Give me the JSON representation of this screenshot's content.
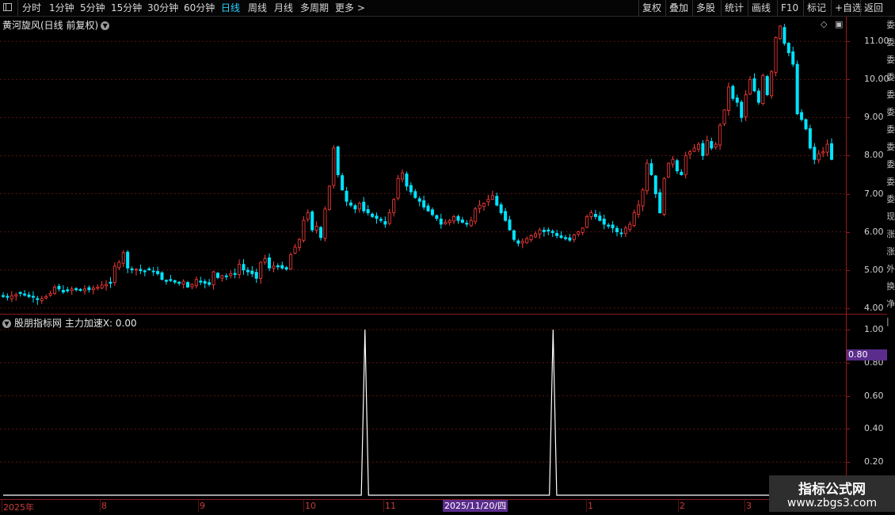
{
  "toolbar": {
    "left_items": [
      "分时",
      "1分钟",
      "5分钟",
      "15分钟",
      "30分钟",
      "60分钟",
      "日线",
      "周线",
      "月线",
      "多周期",
      "更多 >"
    ],
    "active_item": "日线",
    "right_items": [
      "复权",
      "叠加",
      "多股",
      "统计",
      "画线",
      "F10",
      "标记",
      "+自选",
      "返回"
    ]
  },
  "price_panel": {
    "title": "黄河旋风(日线 前复权)"
  },
  "indicator_panel": {
    "title": "股朋指标网 主力加速X: 0.00",
    "marker_value": "0.80"
  },
  "price_axis_labels": [
    "11.00",
    "10.00",
    "9.00",
    "8.00",
    "7.00",
    "6.00",
    "5.00",
    "4.00"
  ],
  "indicator_axis_labels": [
    "1.00",
    "0.80",
    "0.60",
    "0.40",
    "0.20"
  ],
  "date_axis": {
    "labels": [
      "2025年",
      "8",
      "9",
      "10",
      "11",
      "1",
      "2",
      "3"
    ],
    "cursor_date": "2025/11/20/四"
  },
  "side_strip_chars": [
    "委",
    "委",
    "委",
    "委",
    "委",
    "委",
    "委",
    "委",
    "委",
    "委",
    "委",
    "现",
    "涨",
    "涨",
    "外",
    "换",
    "净",
    "|"
  ],
  "watermark": {
    "line1": "指标公式网",
    "line2": "www.zbgs3.com"
  },
  "colors": {
    "up": "#ff3c3c",
    "down": "#00e4ff",
    "grid": "#5a1414",
    "axis": "#9a1a1a",
    "active_tab": "#25d4ff",
    "marker": "#5a2c8c"
  },
  "chart_data": [
    {
      "type": "candlestick",
      "title": "黄河旋风(日线 前复权)",
      "ylim": [
        3.85,
        11.65
      ],
      "yticks": [
        4,
        5,
        6,
        7,
        8,
        9,
        10,
        11
      ],
      "grid": true,
      "close": [
        4.3,
        4.28,
        4.32,
        4.35,
        4.38,
        4.34,
        4.3,
        4.28,
        4.22,
        4.25,
        4.3,
        4.38,
        4.55,
        4.5,
        4.42,
        4.45,
        4.5,
        4.48,
        4.46,
        4.5,
        4.48,
        4.52,
        4.55,
        4.6,
        4.62,
        4.65,
        5.1,
        5.2,
        5.45,
        5.05,
        5.0,
        5.02,
        4.98,
        4.95,
        5.0,
        4.95,
        4.9,
        4.75,
        4.7,
        4.72,
        4.68,
        4.65,
        4.7,
        4.55,
        4.62,
        4.75,
        4.68,
        4.65,
        4.62,
        4.95,
        4.8,
        4.85,
        4.82,
        4.9,
        4.88,
        5.15,
        5.0,
        4.95,
        4.9,
        4.78,
        5.2,
        5.3,
        5.05,
        5.1,
        5.08,
        5.05,
        5.02,
        5.4,
        5.6,
        5.8,
        6.3,
        6.5,
        6.05,
        6.15,
        5.85,
        6.6,
        7.2,
        8.2,
        7.5,
        7.1,
        6.8,
        6.7,
        6.6,
        6.75,
        6.55,
        6.5,
        6.4,
        6.35,
        6.3,
        6.2,
        6.5,
        6.85,
        7.4,
        7.55,
        7.2,
        7.05,
        6.9,
        6.8,
        6.65,
        6.55,
        6.45,
        6.35,
        6.2,
        6.25,
        6.3,
        6.4,
        6.3,
        6.25,
        6.2,
        6.3,
        6.6,
        6.7,
        6.75,
        6.85,
        6.95,
        6.7,
        6.5,
        6.3,
        6.05,
        5.8,
        5.7,
        5.75,
        5.82,
        5.9,
        5.95,
        6.05,
        6.0,
        6.02,
        5.98,
        5.9,
        5.85,
        5.82,
        5.78,
        5.92,
        6.0,
        6.1,
        6.4,
        6.5,
        6.4,
        6.3,
        6.2,
        6.15,
        6.1,
        6.0,
        5.95,
        6.1,
        6.2,
        6.5,
        6.7,
        7.1,
        7.8,
        7.5,
        7.0,
        6.5,
        7.4,
        7.8,
        7.9,
        7.6,
        7.5,
        8.0,
        8.1,
        8.2,
        8.3,
        8.0,
        8.4,
        8.2,
        8.3,
        8.8,
        9.2,
        9.8,
        9.5,
        9.4,
        9.0,
        9.6,
        10.0,
        9.7,
        9.4,
        10.1,
        9.6,
        10.2,
        11.1,
        11.4,
        10.95,
        10.7,
        10.4,
        9.1,
        8.95,
        8.7,
        8.2,
        7.9,
        8.05,
        8.1,
        8.3,
        7.9
      ],
      "high_low": "estimated visually",
      "cursor_date": "2025/11/20/四"
    },
    {
      "type": "line",
      "title": "股朋指标网 主力加速X: 0.00",
      "ylim": [
        0,
        1.05
      ],
      "yticks": [
        0.2,
        0.4,
        0.6,
        0.8,
        1.0
      ],
      "spikes": [
        {
          "index": 100,
          "value": 1.0
        },
        {
          "index": 152,
          "value": 1.0
        }
      ],
      "baseline": 0,
      "series_length": 230
    }
  ]
}
